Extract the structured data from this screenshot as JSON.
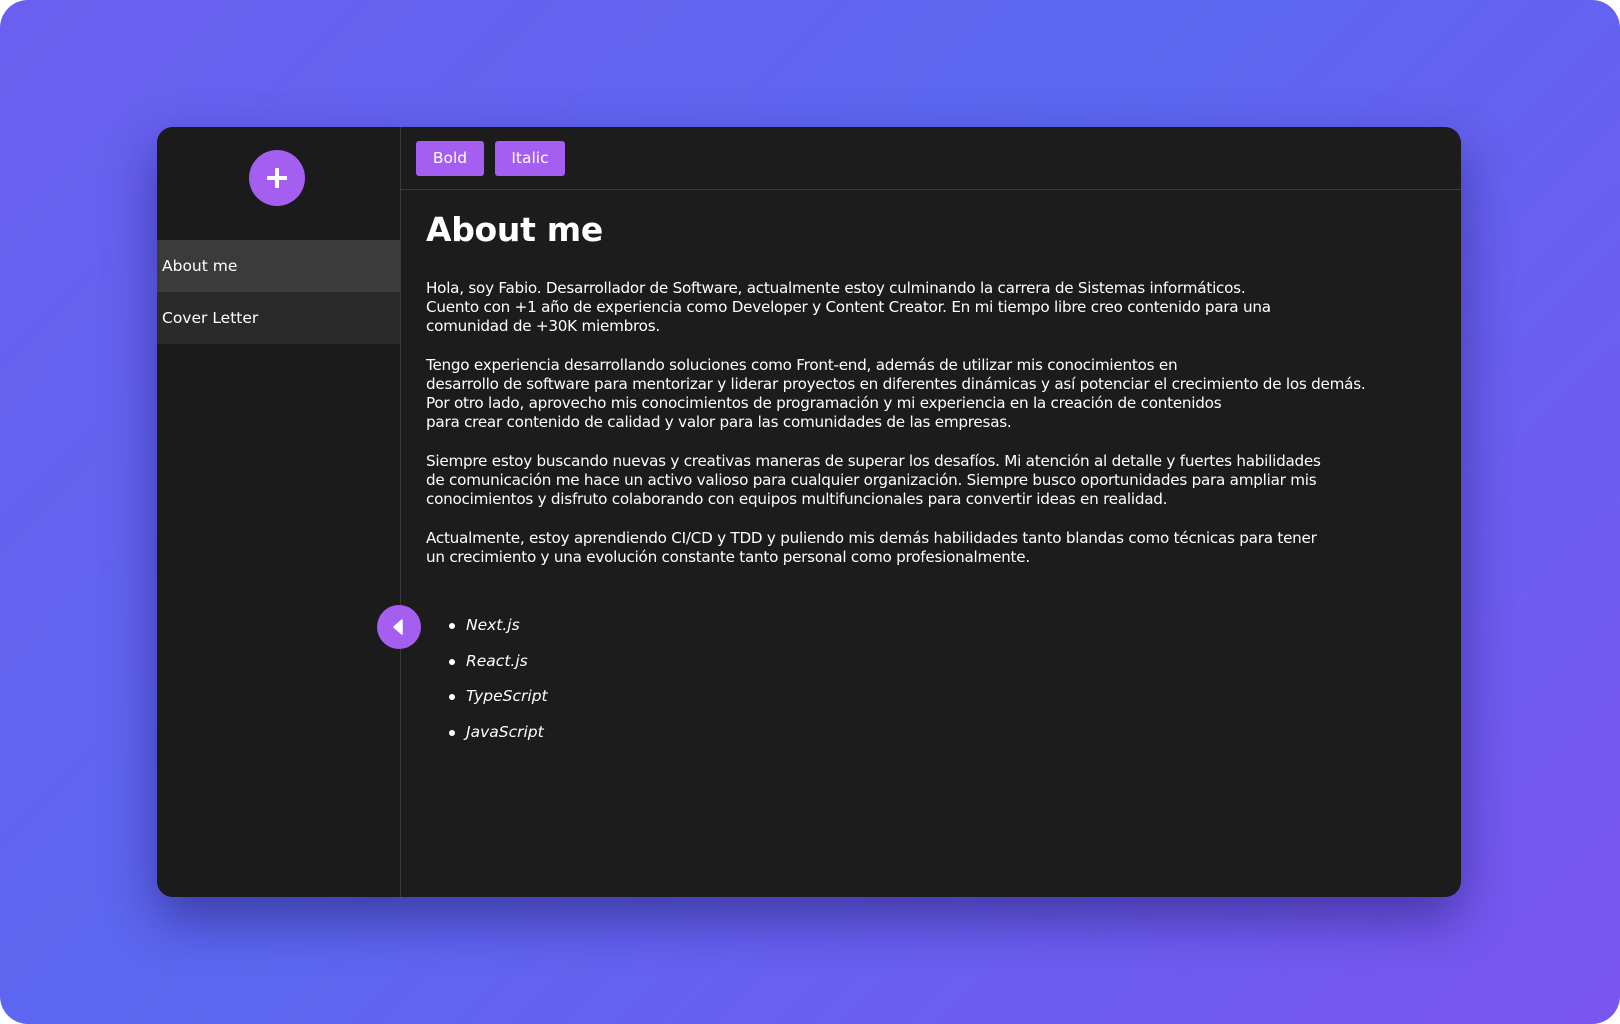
{
  "sidebar": {
    "add_button_icon": "plus-icon",
    "items": [
      {
        "label": "About me",
        "active": true
      },
      {
        "label": "Cover Letter",
        "active": false
      }
    ]
  },
  "toolbar": {
    "bold_label": "Bold",
    "italic_label": "Italic"
  },
  "document": {
    "title": "About me",
    "paragraphs": [
      "Hola, soy Fabio. Desarrollador de Software, actualmente estoy culminando la carrera de Sistemas informáticos.\nCuento con +1 año de experiencia como Developer y Content Creator. En mi tiempo libre creo contenido para una\ncomunidad de +30K miembros.",
      "Tengo experiencia desarrollando soluciones como Front-end, además de utilizar mis conocimientos en\ndesarrollo de software para mentorizar y liderar proyectos en diferentes dinámicas y así potenciar el crecimiento de los demás.\nPor otro lado, aprovecho mis conocimientos de programación y mi experiencia en la creación de contenidos\npara crear contenido de calidad y valor para las comunidades de las empresas.",
      "Siempre estoy buscando nuevas y creativas maneras de superar los desafíos. Mi atención al detalle y fuertes habilidades\nde comunicación me hace un activo valioso para cualquier organización. Siempre busco oportunidades para ampliar mis\nconocimientos y disfruto colaborando con equipos multifuncionales para convertir ideas en realidad.",
      "Actualmente, estoy aprendiendo CI/CD y TDD y puliendo mis demás habilidades tanto blandas como técnicas para tener\nun crecimiento y una evolución constante tanto personal como profesionalmente."
    ],
    "skills": [
      "Next.js",
      "React.js",
      "TypeScript",
      "JavaScript"
    ]
  },
  "collapse_button_icon": "caret-left-icon",
  "colors": {
    "accent": "#a45ef0",
    "window_bg": "#1c1c1c",
    "nav_active_bg": "#3b3b3b",
    "nav_bg": "#2a2a2a"
  }
}
